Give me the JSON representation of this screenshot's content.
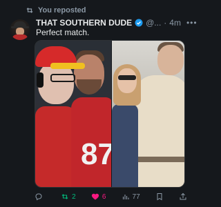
{
  "repost": {
    "label": "You reposted"
  },
  "tweet": {
    "author_name": "THAT SOUTHERN DUDE",
    "handle": "@...",
    "separator": "·",
    "time": "4m",
    "text": "Perfect match."
  },
  "media": {
    "left_jersey_number": "87"
  },
  "actions": {
    "reply_count": "",
    "retweet_count": "2",
    "like_count": "6",
    "view_count": "77"
  },
  "colors": {
    "background": "#15181c",
    "verified": "#1d9bf0",
    "retweet": "#00ba7c",
    "like": "#f91880",
    "muted": "#8b98a5"
  }
}
